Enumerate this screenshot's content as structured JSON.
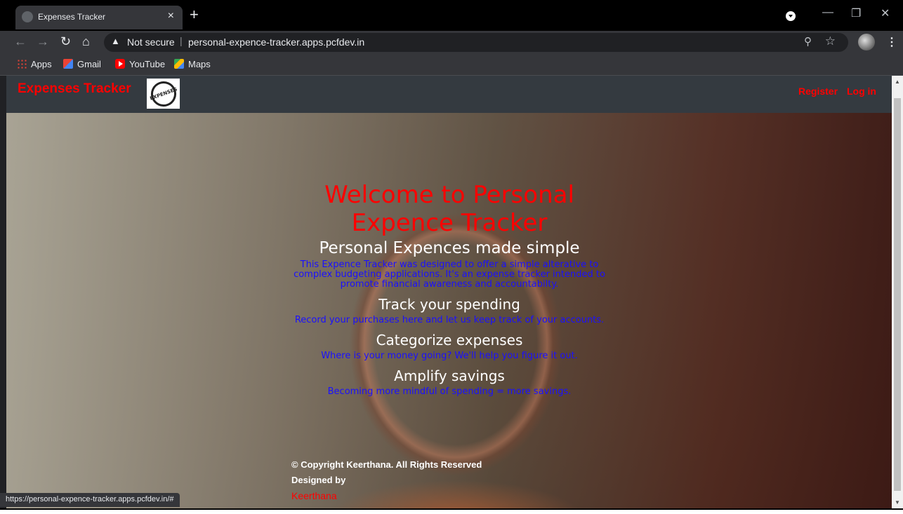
{
  "browser": {
    "tab_title": "Expenses Tracker",
    "tab_close": "×",
    "new_tab": "+",
    "security_label": "Not secure",
    "url": "personal-expence-tracker.apps.pcfdev.in",
    "status_url": "https://personal-expence-tracker.apps.pcfdev.in/#",
    "bookmarks": [
      {
        "label": "Apps",
        "icon": "apps-grid-icon"
      },
      {
        "label": "Gmail",
        "icon": "gmail-icon"
      },
      {
        "label": "YouTube",
        "icon": "youtube-icon"
      },
      {
        "label": "Maps",
        "icon": "maps-icon"
      }
    ]
  },
  "site": {
    "brand": "Expenses Tracker",
    "logo_text": "EXPENSES",
    "nav": {
      "register": "Register",
      "login": "Log in"
    },
    "hero": {
      "title_line1": "Welcome to Personal",
      "title_line2": "Expence Tracker",
      "tagline": "Personal Expences made simple",
      "intro": "This Expence Tracker was designed to offer a simple alterative to complex budgeting applications. It's an expense tracker intended to promote financial awareness and accountabilty.",
      "sections": [
        {
          "heading": "Track your spending",
          "text": "Record your purchases here and let us keep track of your accounts."
        },
        {
          "heading": "Categorize expenses",
          "text": "Where is your money going? We'll help you figure it out."
        },
        {
          "heading": "Amplify savings",
          "text": "Becoming more mindful of spending = more savings."
        }
      ]
    },
    "footer": {
      "copyright": "© Copyright",
      "owner": "Keerthana",
      "rights": ". All Rights Reserved",
      "designed_by": "Designed by",
      "designer": "Keerthana"
    }
  },
  "colors": {
    "brand_red": "#ff0000",
    "nav_bg": "#343a40",
    "text_blue": "#1a10ff"
  }
}
